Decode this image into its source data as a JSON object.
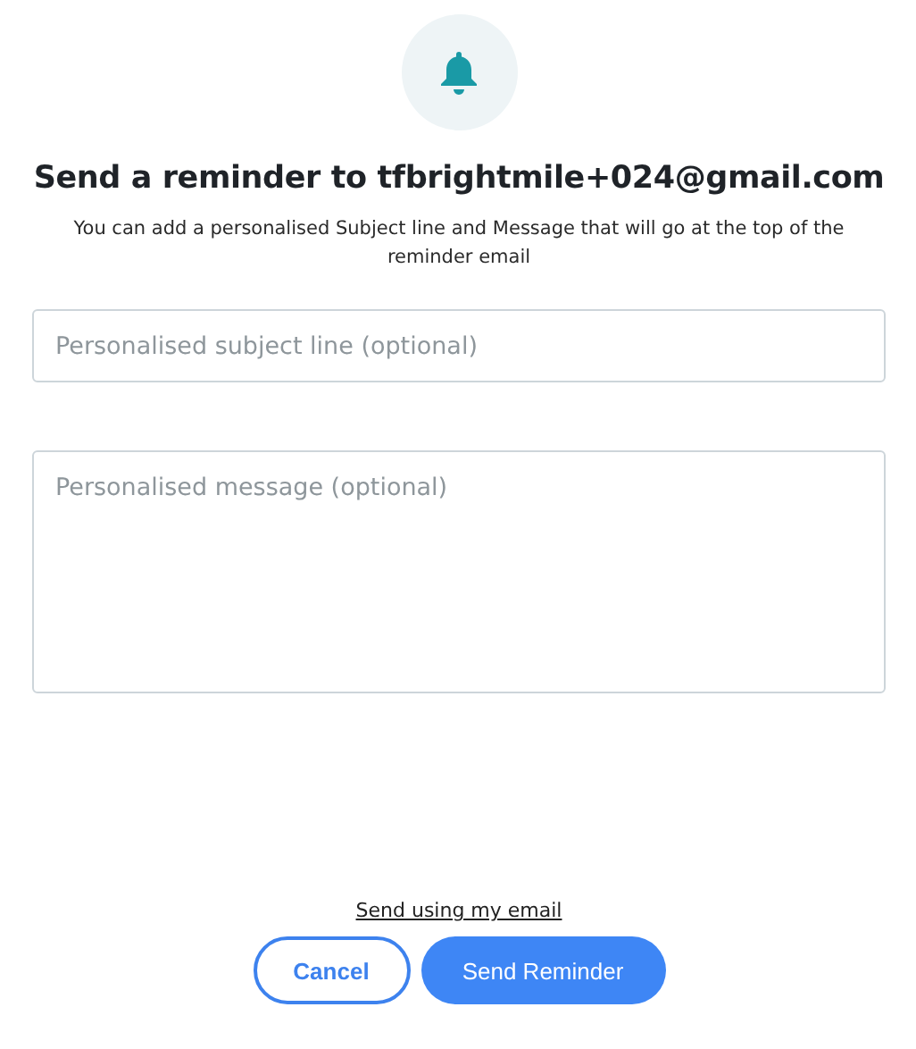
{
  "title": "Send a reminder to tfbrightmile+024@gmail.com",
  "description": "You can add a personalised Subject line and Message that will go at the top of the reminder email",
  "subject_field": {
    "placeholder": "Personalised subject line (optional)"
  },
  "message_field": {
    "placeholder": "Personalised message (optional)"
  },
  "link": "Send using my email",
  "buttons": [
    {
      "label": "Cancel",
      "kind": "secondary"
    },
    {
      "label": "Send Reminder",
      "kind": "primary"
    }
  ]
}
